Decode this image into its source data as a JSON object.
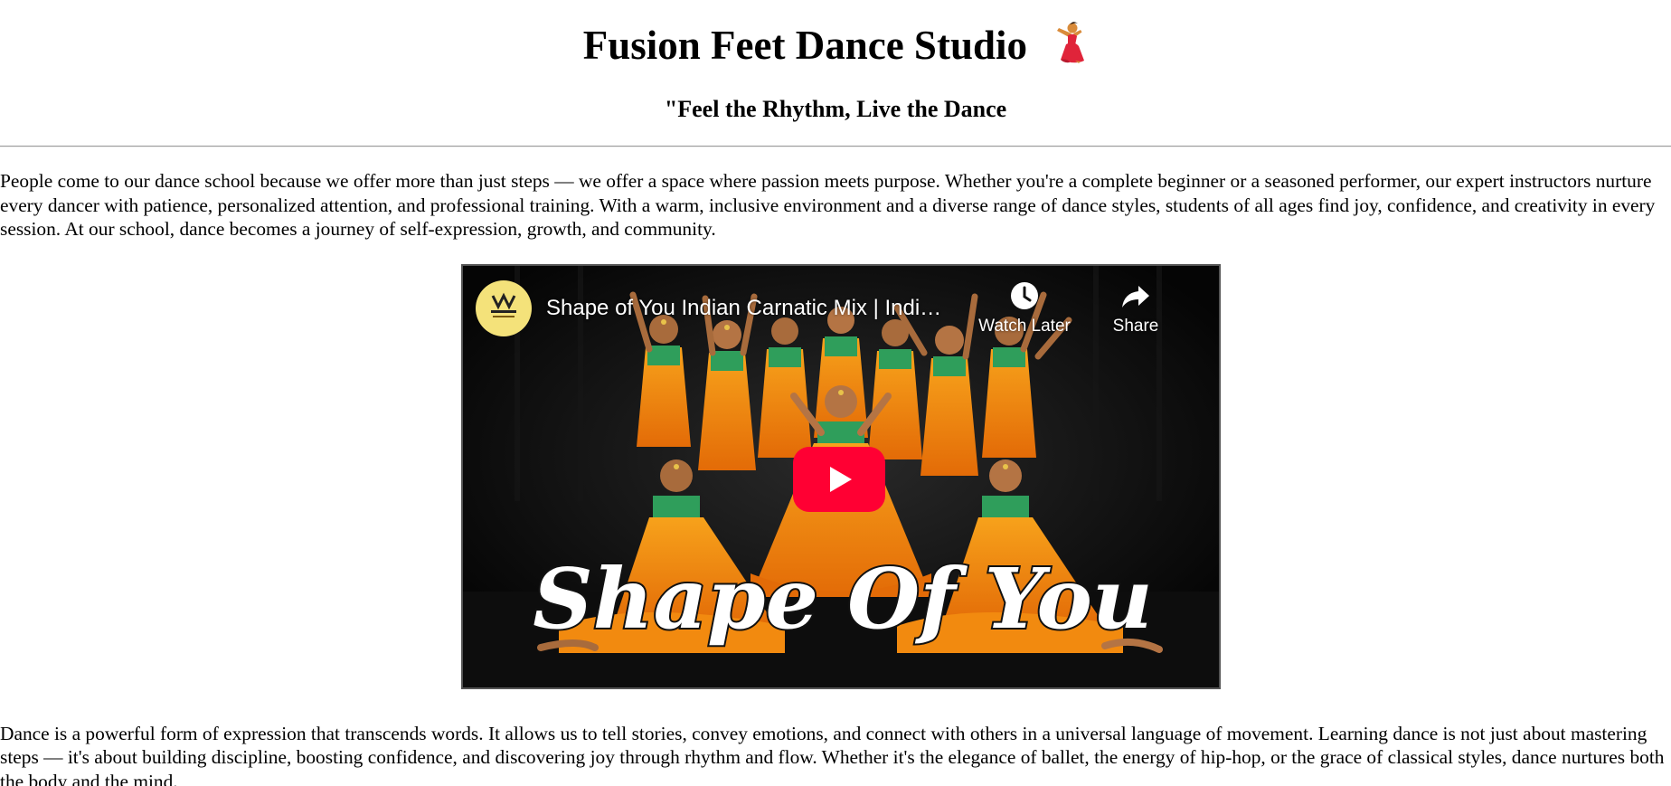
{
  "header": {
    "title": "Fusion Feet Dance Studio",
    "title_emoji": "dancer-icon",
    "tagline": "\"Feel the Rhythm, Live the Dance"
  },
  "content": {
    "intro_paragraph": "People come to our dance school because we offer more than just steps — we offer a space where passion meets purpose. Whether you're a complete beginner or a seasoned performer, our expert instructors nurture every dancer with patience, personalized attention, and professional training. With a warm, inclusive environment and a diverse range of dance styles, students of all ages find joy, confidence, and creativity in every session. At our school, dance becomes a journey of self-expression, growth, and community.",
    "second_paragraph": "Dance is a powerful form of expression that transcends words. It allows us to tell stories, convey emotions, and connect with others in a universal language of movement. Learning dance is not just about mastering steps — it's about building discipline, boosting confidence, and discovering joy through rhythm and flow. Whether it's the elegance of ballet, the energy of hip-hop, or the grace of classical styles, dance nurtures both the body and the mind."
  },
  "video": {
    "title": "Shape of You Indian Carnatic Mix | Indi…",
    "thumbnail_text": "Shape Of You",
    "watch_later_label": "Watch Later",
    "share_label": "Share",
    "play_icon": "play-icon",
    "channel_logo": "channel-logo",
    "colors": {
      "play_red": "#ff0033",
      "saree_orange": "#f28a0f",
      "blouse_green": "#2f9e5b",
      "logo_yellow": "#f4e27a"
    }
  }
}
